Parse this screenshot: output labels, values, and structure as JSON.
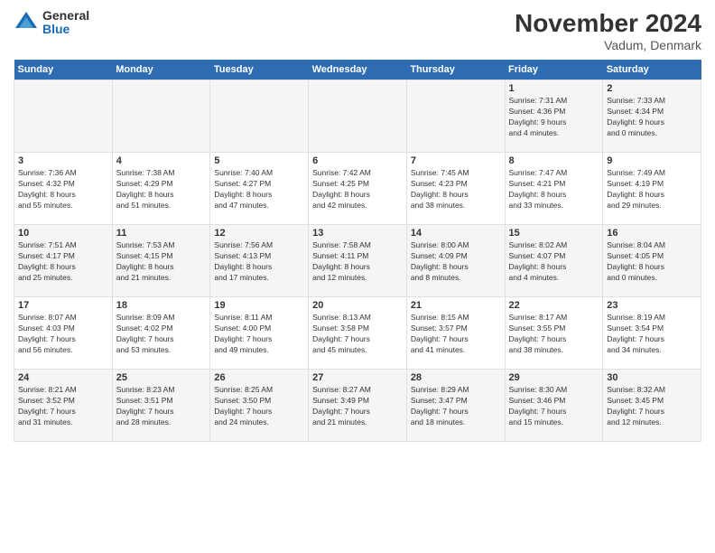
{
  "logo": {
    "general": "General",
    "blue": "Blue"
  },
  "title": "November 2024",
  "location": "Vadum, Denmark",
  "days_of_week": [
    "Sunday",
    "Monday",
    "Tuesday",
    "Wednesday",
    "Thursday",
    "Friday",
    "Saturday"
  ],
  "weeks": [
    [
      {
        "day": "",
        "info": ""
      },
      {
        "day": "",
        "info": ""
      },
      {
        "day": "",
        "info": ""
      },
      {
        "day": "",
        "info": ""
      },
      {
        "day": "",
        "info": ""
      },
      {
        "day": "1",
        "info": "Sunrise: 7:31 AM\nSunset: 4:36 PM\nDaylight: 9 hours\nand 4 minutes."
      },
      {
        "day": "2",
        "info": "Sunrise: 7:33 AM\nSunset: 4:34 PM\nDaylight: 9 hours\nand 0 minutes."
      }
    ],
    [
      {
        "day": "3",
        "info": "Sunrise: 7:36 AM\nSunset: 4:32 PM\nDaylight: 8 hours\nand 55 minutes."
      },
      {
        "day": "4",
        "info": "Sunrise: 7:38 AM\nSunset: 4:29 PM\nDaylight: 8 hours\nand 51 minutes."
      },
      {
        "day": "5",
        "info": "Sunrise: 7:40 AM\nSunset: 4:27 PM\nDaylight: 8 hours\nand 47 minutes."
      },
      {
        "day": "6",
        "info": "Sunrise: 7:42 AM\nSunset: 4:25 PM\nDaylight: 8 hours\nand 42 minutes."
      },
      {
        "day": "7",
        "info": "Sunrise: 7:45 AM\nSunset: 4:23 PM\nDaylight: 8 hours\nand 38 minutes."
      },
      {
        "day": "8",
        "info": "Sunrise: 7:47 AM\nSunset: 4:21 PM\nDaylight: 8 hours\nand 33 minutes."
      },
      {
        "day": "9",
        "info": "Sunrise: 7:49 AM\nSunset: 4:19 PM\nDaylight: 8 hours\nand 29 minutes."
      }
    ],
    [
      {
        "day": "10",
        "info": "Sunrise: 7:51 AM\nSunset: 4:17 PM\nDaylight: 8 hours\nand 25 minutes."
      },
      {
        "day": "11",
        "info": "Sunrise: 7:53 AM\nSunset: 4:15 PM\nDaylight: 8 hours\nand 21 minutes."
      },
      {
        "day": "12",
        "info": "Sunrise: 7:56 AM\nSunset: 4:13 PM\nDaylight: 8 hours\nand 17 minutes."
      },
      {
        "day": "13",
        "info": "Sunrise: 7:58 AM\nSunset: 4:11 PM\nDaylight: 8 hours\nand 12 minutes."
      },
      {
        "day": "14",
        "info": "Sunrise: 8:00 AM\nSunset: 4:09 PM\nDaylight: 8 hours\nand 8 minutes."
      },
      {
        "day": "15",
        "info": "Sunrise: 8:02 AM\nSunset: 4:07 PM\nDaylight: 8 hours\nand 4 minutes."
      },
      {
        "day": "16",
        "info": "Sunrise: 8:04 AM\nSunset: 4:05 PM\nDaylight: 8 hours\nand 0 minutes."
      }
    ],
    [
      {
        "day": "17",
        "info": "Sunrise: 8:07 AM\nSunset: 4:03 PM\nDaylight: 7 hours\nand 56 minutes."
      },
      {
        "day": "18",
        "info": "Sunrise: 8:09 AM\nSunset: 4:02 PM\nDaylight: 7 hours\nand 53 minutes."
      },
      {
        "day": "19",
        "info": "Sunrise: 8:11 AM\nSunset: 4:00 PM\nDaylight: 7 hours\nand 49 minutes."
      },
      {
        "day": "20",
        "info": "Sunrise: 8:13 AM\nSunset: 3:58 PM\nDaylight: 7 hours\nand 45 minutes."
      },
      {
        "day": "21",
        "info": "Sunrise: 8:15 AM\nSunset: 3:57 PM\nDaylight: 7 hours\nand 41 minutes."
      },
      {
        "day": "22",
        "info": "Sunrise: 8:17 AM\nSunset: 3:55 PM\nDaylight: 7 hours\nand 38 minutes."
      },
      {
        "day": "23",
        "info": "Sunrise: 8:19 AM\nSunset: 3:54 PM\nDaylight: 7 hours\nand 34 minutes."
      }
    ],
    [
      {
        "day": "24",
        "info": "Sunrise: 8:21 AM\nSunset: 3:52 PM\nDaylight: 7 hours\nand 31 minutes."
      },
      {
        "day": "25",
        "info": "Sunrise: 8:23 AM\nSunset: 3:51 PM\nDaylight: 7 hours\nand 28 minutes."
      },
      {
        "day": "26",
        "info": "Sunrise: 8:25 AM\nSunset: 3:50 PM\nDaylight: 7 hours\nand 24 minutes."
      },
      {
        "day": "27",
        "info": "Sunrise: 8:27 AM\nSunset: 3:49 PM\nDaylight: 7 hours\nand 21 minutes."
      },
      {
        "day": "28",
        "info": "Sunrise: 8:29 AM\nSunset: 3:47 PM\nDaylight: 7 hours\nand 18 minutes."
      },
      {
        "day": "29",
        "info": "Sunrise: 8:30 AM\nSunset: 3:46 PM\nDaylight: 7 hours\nand 15 minutes."
      },
      {
        "day": "30",
        "info": "Sunrise: 8:32 AM\nSunset: 3:45 PM\nDaylight: 7 hours\nand 12 minutes."
      }
    ]
  ]
}
